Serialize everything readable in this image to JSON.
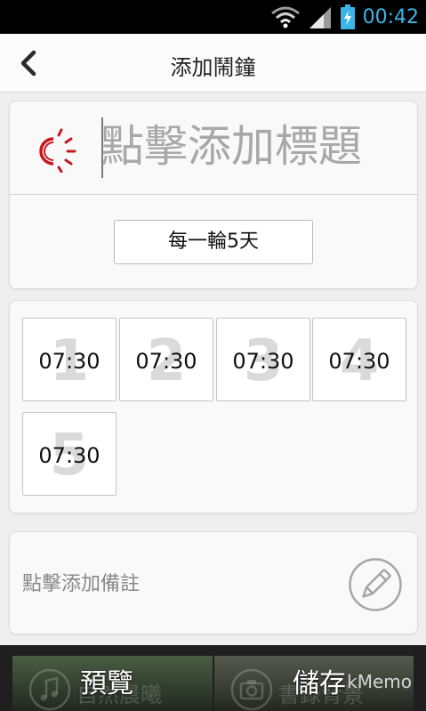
{
  "status_bar": {
    "time": "00:42"
  },
  "header": {
    "title": "添加鬧鐘"
  },
  "title_card": {
    "title_placeholder": "點擊添加標題",
    "cycle_label": "每一輪5天",
    "accent_color": "#c8171e"
  },
  "times": [
    {
      "index": "1",
      "time": "07:30"
    },
    {
      "index": "2",
      "time": "07:30"
    },
    {
      "index": "3",
      "time": "07:30"
    },
    {
      "index": "4",
      "time": "07:30"
    },
    {
      "index": "5",
      "time": "07:30"
    }
  ],
  "note": {
    "placeholder": "點擊添加備註"
  },
  "bottom_bar": {
    "preview_label": "預覽",
    "preview_bg_label": "自然晨曦",
    "save_label": "儲存",
    "save_bg_label": "書錄背景"
  },
  "watermark": "kMemo",
  "colors": {
    "clock": "#3db4e6",
    "accent": "#c8171e"
  },
  "icons": [
    "wifi-icon",
    "signal-icon",
    "battery-icon",
    "back-chevron-icon",
    "sun-icon",
    "pencil-icon",
    "music-note-icon",
    "camera-icon"
  ]
}
